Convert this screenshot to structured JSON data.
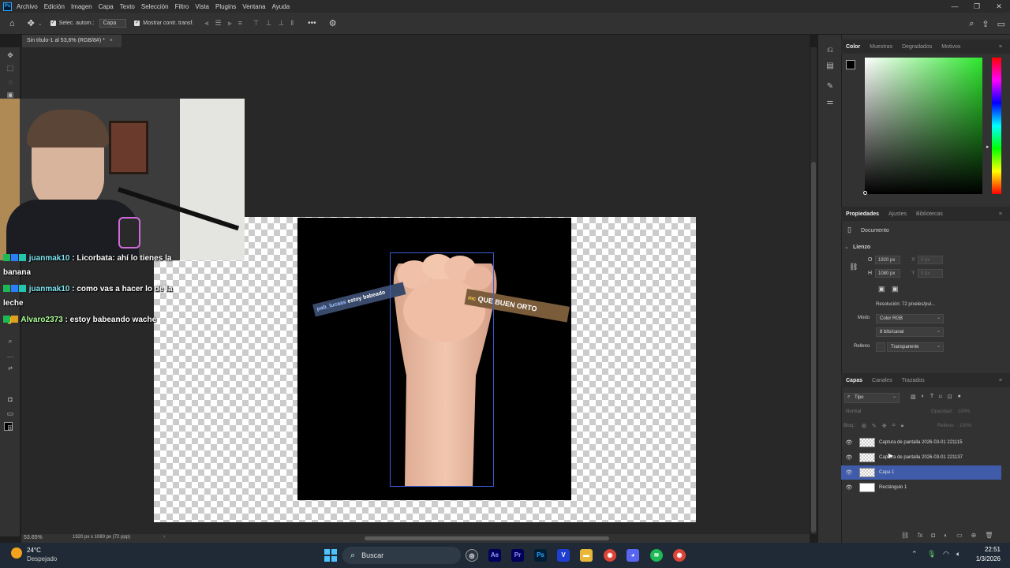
{
  "app": {
    "menu": [
      "Archivo",
      "Edición",
      "Imagen",
      "Capa",
      "Texto",
      "Selección",
      "Filtro",
      "Vista",
      "Plugins",
      "Ventana",
      "Ayuda"
    ],
    "window_controls": [
      "—",
      "❐",
      "✕"
    ]
  },
  "options": {
    "auto_select_label": "Selec. autom.:",
    "auto_select_value": "Capa",
    "show_transform_label": "Mostrar contr. transf.",
    "more_label": "•••"
  },
  "document": {
    "tab_title": "Sin título-1 al 53,6% (RGB/8#) *",
    "zoom": "53.65%",
    "status": "1920 px x 1080 px (72 ppp)"
  },
  "canvas": {
    "sticker_left": "estoy babeado",
    "sticker_left_user": "pab_lucaas",
    "sticker_right": "QUE BUEN ORTO",
    "sticker_right_user": "mc"
  },
  "chat": [
    {
      "user": "juanmak10",
      "text": ": Licorbata: ahí lo tienes la",
      "cont": "banana"
    },
    {
      "user": "juanmak10",
      "text": ": como vas a hacer lo de la",
      "cont": "leche"
    },
    {
      "user": "Alvaro2373",
      "text": ": estoy babeando wache",
      "cont": ""
    }
  ],
  "color_panel": {
    "tabs": [
      "Color",
      "Muestras",
      "Degradados",
      "Motivos"
    ],
    "foreground": "#000000",
    "hue_color": "#2de82d"
  },
  "properties": {
    "tabs": [
      "Propiedades",
      "Ajustes",
      "Bibliotecas"
    ],
    "doc_label": "Documento",
    "section": "Lienzo",
    "w_label": "O",
    "w_value": "1920 px",
    "h_label": "H",
    "h_value": "1080 px",
    "x_label": "X",
    "x_value": "0 px",
    "y_label": "Y",
    "y_value": "0 px",
    "resolution": "Resolución: 72 píxeles/pul...",
    "mode_label": "Modo",
    "mode_value": "Color RGB",
    "bits_value": "8 bits/canal",
    "fill_label": "Relleno",
    "fill_value": "Transparente"
  },
  "layers_panel": {
    "tabs": [
      "Capas",
      "Canales",
      "Trazados"
    ],
    "filter_value": "Tipo",
    "blend_mode": "Normal",
    "opacity_label": "Opacidad:",
    "opacity_value": "100%",
    "lock_label": "Bloq.:",
    "fill_label": "Relleno:",
    "fill_value": "100%",
    "layers": [
      {
        "name": "Captura de pantalla 2026-03-01 221115",
        "selected": false
      },
      {
        "name": "Captura de pantalla 2026-03-01 221137",
        "selected": false
      },
      {
        "name": "Capa 1",
        "selected": true
      },
      {
        "name": "Rectángulo 1",
        "selected": false
      }
    ]
  },
  "taskbar": {
    "temperature": "24°C",
    "weather": "Despejado",
    "search_placeholder": "Buscar",
    "time": "22:51",
    "date": "1/3/2026"
  }
}
